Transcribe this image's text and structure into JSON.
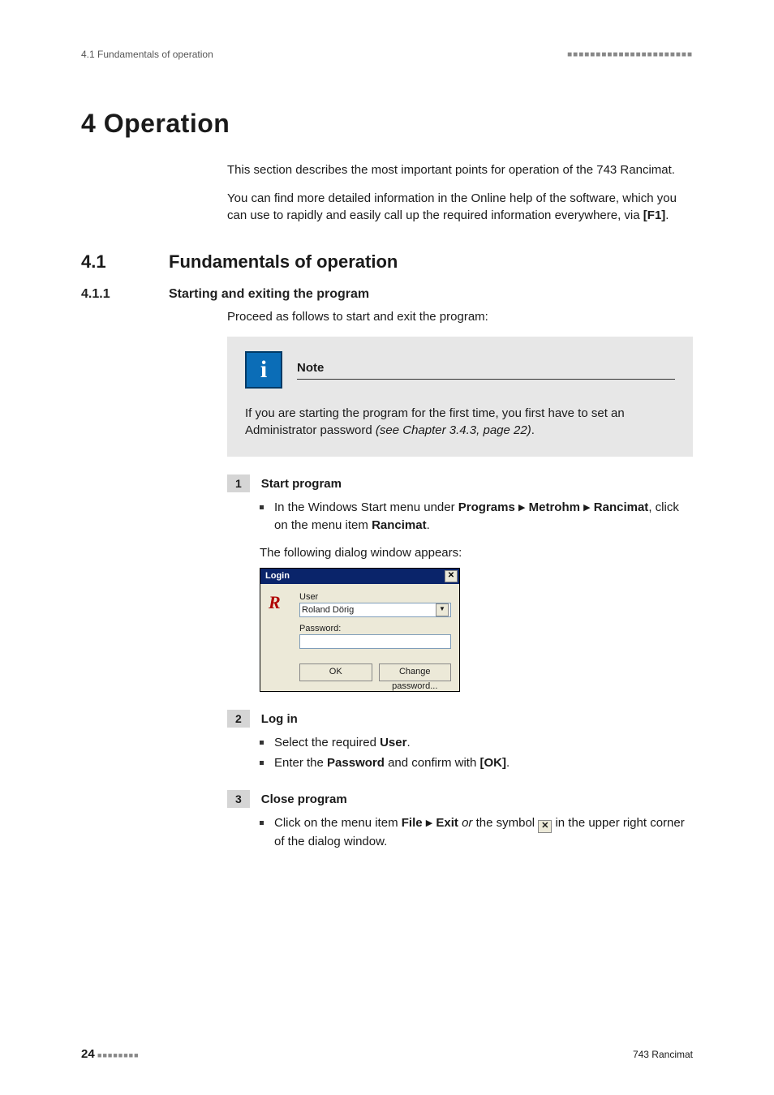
{
  "header": {
    "left": "4.1 Fundamentals of operation",
    "right_dashes": "■■■■■■■■■■■■■■■■■■■■■■"
  },
  "chapter": {
    "num": "4",
    "title": "Operation",
    "combined": "4   Operation"
  },
  "intro": {
    "p1": "This section describes the most important points for operation of the 743 Rancimat.",
    "p2_a": "You can find more detailed information in the Online help of the software, which you can use to rapidly and easily call up the required information everywhere, via ",
    "p2_key": "[F1]",
    "p2_b": "."
  },
  "section": {
    "num": "4.1",
    "title": "Fundamentals of operation"
  },
  "subsection": {
    "num": "4.1.1",
    "title": "Starting and exiting the program",
    "lead": "Proceed as follows to start and exit the program:"
  },
  "note": {
    "title": "Note",
    "text_a": "If you are starting the program for the first time, you first have to set an Administrator password ",
    "text_ital": "(see Chapter 3.4.3, page 22)",
    "text_b": "."
  },
  "step1": {
    "num": "1",
    "title": "Start program",
    "bullet_a": "In the Windows Start menu under ",
    "b1": "Programs",
    "b2": "Metrohm",
    "b3": "Rancimat",
    "bullet_mid": ", click on the menu item ",
    "b4": "Rancimat",
    "bullet_end": ".",
    "after": "The following dialog window appears:"
  },
  "dialog": {
    "title": "Login",
    "user_label": "User",
    "user_value": "Roland Dörig",
    "password_label": "Password:",
    "password_value": "",
    "ok": "OK",
    "change": "Change password..."
  },
  "step2": {
    "num": "2",
    "title": "Log in",
    "b1_a": "Select the required ",
    "b1_b": "User",
    "b1_c": ".",
    "b2_a": "Enter the ",
    "b2_b": "Password",
    "b2_c": " and confirm with ",
    "b2_d": "[OK]",
    "b2_e": "."
  },
  "step3": {
    "num": "3",
    "title": "Close program",
    "b1_a": "Click on the menu item ",
    "b1_b": "File",
    "b1_c": "Exit",
    "b1_or": " or",
    "b1_d": " the symbol ",
    "b1_e": " in the upper right corner of the dialog window."
  },
  "footer": {
    "page": "24",
    "left_dashes": "■■■■■■■■",
    "right": "743 Rancimat"
  }
}
